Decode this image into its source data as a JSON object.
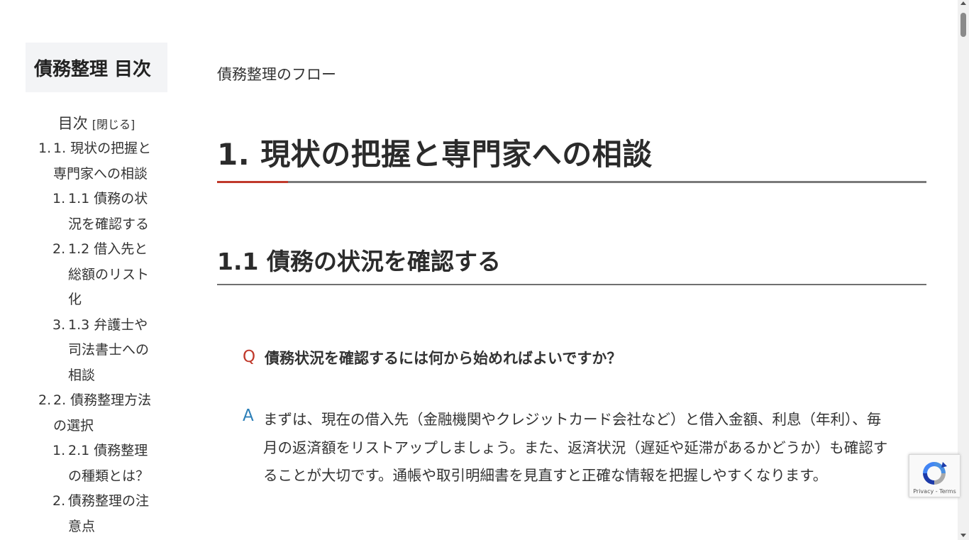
{
  "sidebar": {
    "title": "債務整理 目次",
    "toc_header": "目次",
    "toc_toggle": "[閉じる]",
    "items": [
      {
        "number": "1.",
        "label": "1. 現状の把握と専門家への相談",
        "level": 1
      },
      {
        "number": "1.",
        "label": "1.1 債務の状況を確認する",
        "level": 2
      },
      {
        "number": "2.",
        "label": "1.2 借入先と総額のリスト化",
        "level": 2
      },
      {
        "number": "3.",
        "label": "1.3 弁護士や司法書士への相談",
        "level": 2
      },
      {
        "number": "2.",
        "label": "2. 債務整理方法の選択",
        "level": 1
      },
      {
        "number": "1.",
        "label": "2.1 債務整理の種類とは？",
        "level": 2
      },
      {
        "number": "2.",
        "label": "債務整理の注意点",
        "level": 2
      }
    ]
  },
  "main": {
    "breadcrumb": "債務整理のフロー",
    "h1": "1. 現状の把握と専門家への相談",
    "h2": "1.1 債務の状況を確認する",
    "qa": {
      "q_mark": "Q",
      "question": "債務状況を確認するには何から始めればよいですか？",
      "a_mark": "A",
      "answer": "まずは、現在の借入先（金融機関やクレジットカード会社など）と借入金額、利息（年利）、毎月の返済額をリストアップしましょう。また、返済状況（遅延や延滞があるかどうか）も確認することが大切です。通帳や取引明細書を見直すと正確な情報を把握しやすくなります。"
    }
  },
  "recaptcha": {
    "privacy": "Privacy",
    "separator": " - ",
    "terms": "Terms"
  },
  "colors": {
    "q_mark": "#c0392b",
    "a_mark": "#2c7fb8",
    "h1_accent": "#c0392b",
    "sidebar_title_bg": "#f3f4f6"
  }
}
